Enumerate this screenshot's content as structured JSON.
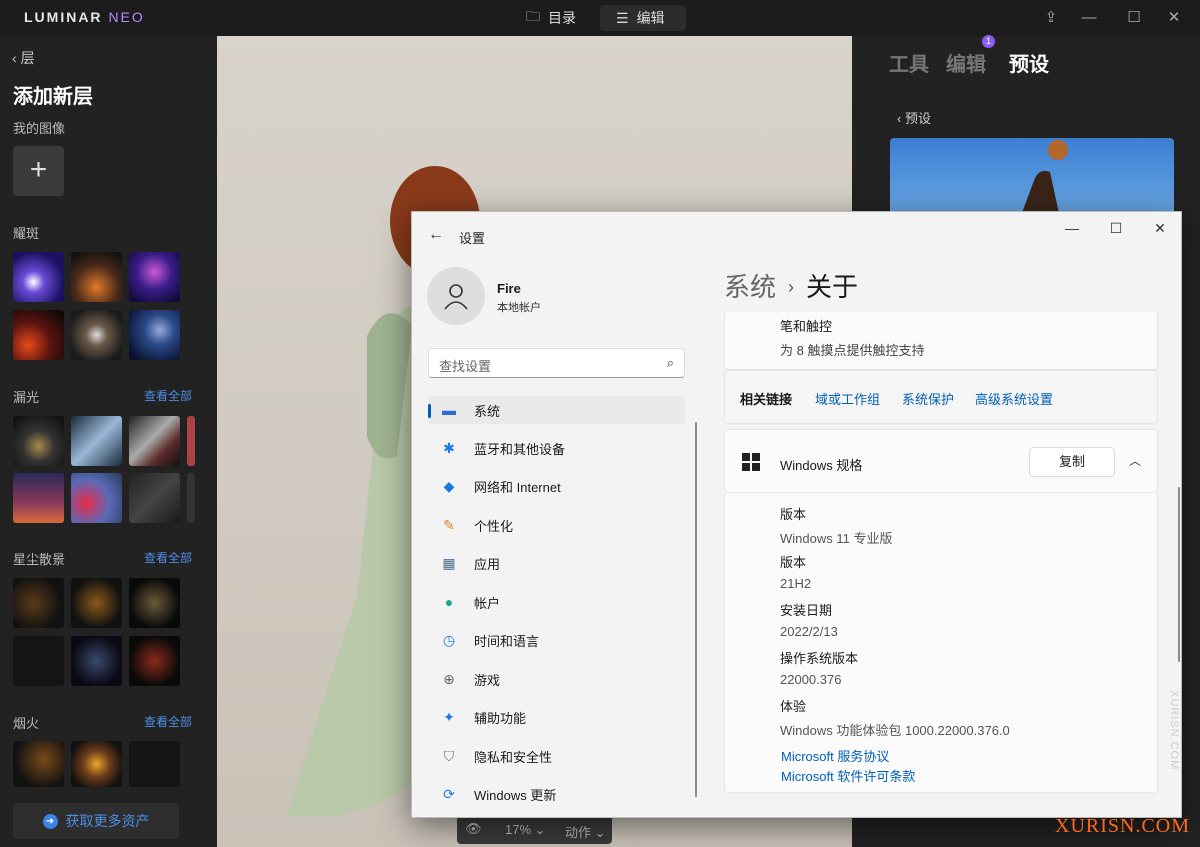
{
  "app": {
    "logo": "LUMINAR",
    "logo_suffix": "NEO",
    "catalog_label": "目录",
    "edit_label": "编辑"
  },
  "left": {
    "back_label": "层",
    "title": "添加新层",
    "my_images": "我的图像",
    "sections": [
      {
        "title": "耀斑",
        "link": ""
      },
      {
        "title": "漏光",
        "link": "查看全部"
      },
      {
        "title": "星尘散景",
        "link": "查看全部"
      },
      {
        "title": "烟火",
        "link": "查看全部"
      }
    ],
    "get_assets": "获取更多资产"
  },
  "viewbar": {
    "zoom": "17%",
    "actions": "动作"
  },
  "right": {
    "tabs": [
      "工具",
      "编辑",
      "预设"
    ],
    "badge": "1",
    "back_label": "预设"
  },
  "settings": {
    "title": "设置",
    "user_name": "Fire",
    "user_type": "本地帐户",
    "search_placeholder": "查找设置",
    "nav": [
      {
        "label": "系统",
        "icon": "system-icon"
      },
      {
        "label": "蓝牙和其他设备",
        "icon": "bluetooth-icon"
      },
      {
        "label": "网络和 Internet",
        "icon": "network-icon"
      },
      {
        "label": "个性化",
        "icon": "brush-icon"
      },
      {
        "label": "应用",
        "icon": "apps-icon"
      },
      {
        "label": "帐户",
        "icon": "account-icon"
      },
      {
        "label": "时间和语言",
        "icon": "time-icon"
      },
      {
        "label": "游戏",
        "icon": "gamepad-icon"
      },
      {
        "label": "辅助功能",
        "icon": "accessibility-icon"
      },
      {
        "label": "隐私和安全性",
        "icon": "shield-icon"
      },
      {
        "label": "Windows 更新",
        "icon": "update-icon"
      }
    ],
    "crumb_parent": "系统",
    "crumb_current": "关于",
    "pen_title": "笔和触控",
    "pen_desc": "为 8 触摸点提供触控支持",
    "related_label": "相关链接",
    "related_links": [
      "域或工作组",
      "系统保护",
      "高级系统设置"
    ],
    "winspec_title": "Windows 规格",
    "copy_label": "复制",
    "specs": [
      {
        "key": "版本",
        "value": "Windows 11 专业版"
      },
      {
        "key": "版本",
        "value": "21H2"
      },
      {
        "key": "安装日期",
        "value": "2022/2/13"
      },
      {
        "key": "操作系统版本",
        "value": "22000.376"
      },
      {
        "key": "体验",
        "value": "Windows 功能体验包 1000.22000.376.0"
      }
    ],
    "links": [
      "Microsoft 服务协议",
      "Microsoft 软件许可条款"
    ]
  },
  "watermark": "XURISN.COM",
  "watermark_side": "XURISN.COM",
  "colors": {
    "accent_win": "#005fb8",
    "accent_luminar": "#4d8fe6",
    "watermark": "#ff6a1a"
  }
}
